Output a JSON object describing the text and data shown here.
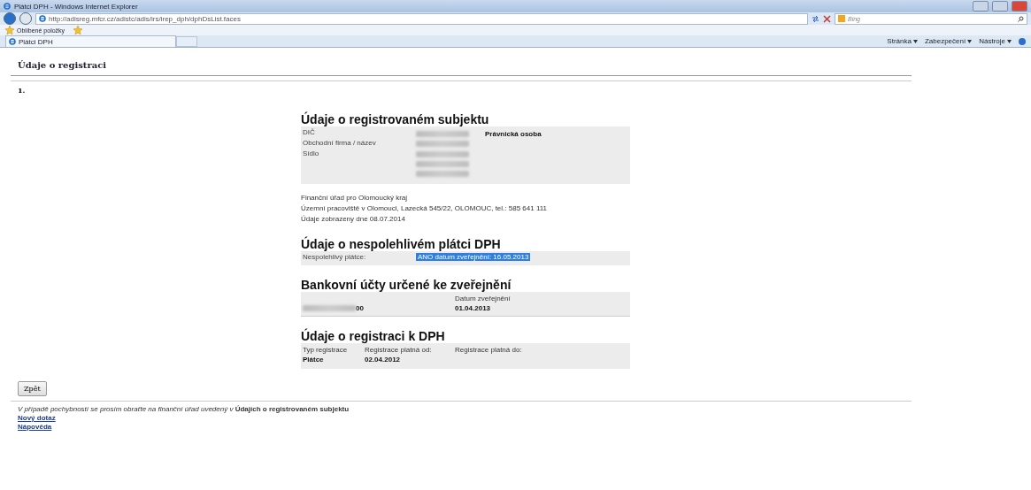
{
  "window": {
    "title": "Plátci DPH - Windows Internet Explorer"
  },
  "address": {
    "url": "http://adisreg.mfcr.cz/adistc/adis/irs/irep_dph/dphDsList.faces",
    "search_placeholder": "Bing"
  },
  "favorites": {
    "label": "Oblíbené položky"
  },
  "tab": {
    "label": "Plátci DPH",
    "selected": true
  },
  "commands": [
    "Stránka",
    "Zabezpečení",
    "Nástroje"
  ],
  "page": {
    "title": "Údaje o registraci",
    "number": "1.",
    "subject": {
      "heading": "Údaje o registrovaném subjektu",
      "rows": [
        {
          "label": "DIČ",
          "parts": [
            {
              "kind": "redacted"
            },
            {
              "kind": "text",
              "text": "Právnická osoba",
              "bold": true
            }
          ]
        },
        {
          "label": "Obchodní firma / název",
          "parts": [
            {
              "kind": "redacted"
            }
          ]
        },
        {
          "label": "Sídlo",
          "parts": [
            {
              "kind": "redacted"
            },
            {
              "kind": "redacted"
            },
            {
              "kind": "redacted"
            }
          ]
        }
      ]
    },
    "office": [
      "Finanční úřad pro Olomoucký kraj",
      "Územní pracoviště v Olomouci, Lazecká 545/22, OLOMOUC, tel.: 585 641 111",
      "Údaje zobrazeny dne 08.07.2014"
    ],
    "unreliable": {
      "heading": "Údaje o nespolehlivém plátci DPH",
      "label": "Nespolehlivý plátce:",
      "value": "ANO datum zveřejnění: 16.05.2013",
      "highlighted": true
    },
    "accounts": {
      "heading": "Bankovní účty určené ke zveřejnění",
      "account_suffix": "00",
      "date_label": "Datum zveřejnění",
      "date": "01.04.2013"
    },
    "registration": {
      "heading": "Údaje o registraci k DPH",
      "columns": [
        {
          "label": "Typ registrace",
          "value": "Plátce"
        },
        {
          "label": "Registrace platná od:",
          "value": "02.04.2012"
        },
        {
          "label": "Registrace platná do:"
        }
      ]
    },
    "back_button": "Zpět",
    "notice": "*V případě pochybností se prosím obraťte na finanční úřad uvedený v* **Údajích o registrovaném subjektu**",
    "links": [
      "Nový dotaz",
      "Nápověda"
    ]
  }
}
